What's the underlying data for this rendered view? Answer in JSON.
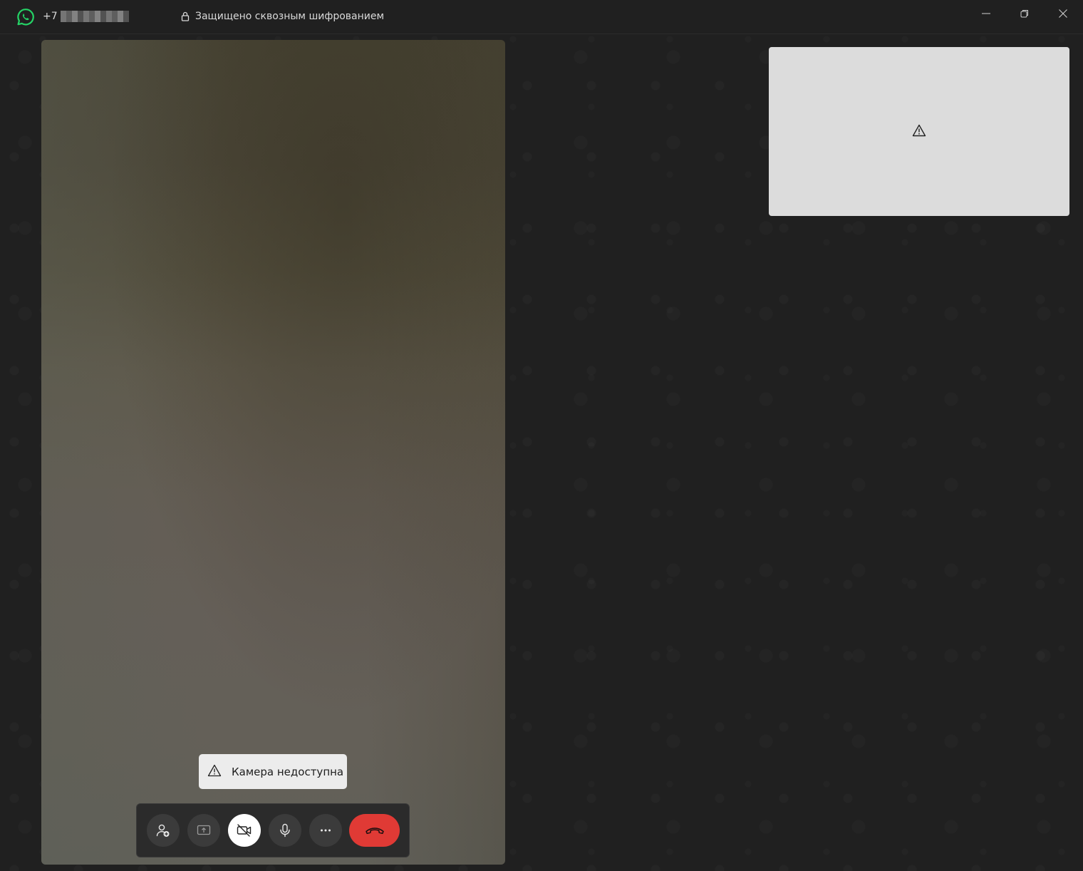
{
  "titlebar": {
    "phone_prefix": "+7",
    "encryption_text": "Защищено сквозным шифрованием",
    "icons": {
      "logo": "whatsapp-logo-icon",
      "lock": "lock-icon",
      "minimize": "minimize-icon",
      "maximize": "restore-icon",
      "close": "close-icon"
    }
  },
  "self_view": {
    "icon": "warning-icon"
  },
  "toast": {
    "icon": "warning-icon",
    "message": "Камера недоступна"
  },
  "controls": {
    "buttons": [
      {
        "name": "add-participant-button",
        "icon": "add-person-icon"
      },
      {
        "name": "share-screen-button",
        "icon": "share-screen-icon"
      },
      {
        "name": "camera-toggle-button",
        "icon": "camera-off-icon",
        "state": "active"
      },
      {
        "name": "mute-button",
        "icon": "microphone-icon"
      },
      {
        "name": "more-options-button",
        "icon": "more-icon"
      },
      {
        "name": "end-call-button",
        "icon": "hang-up-icon"
      }
    ]
  },
  "colors": {
    "brand": "#25d366",
    "end_call": "#e03a35",
    "background": "#202020",
    "control_button": "#3b3b3b"
  }
}
